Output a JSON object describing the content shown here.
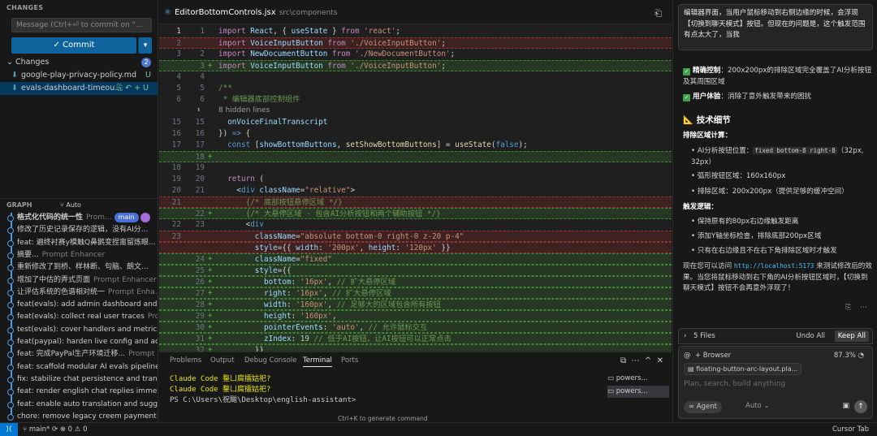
{
  "left": {
    "changes_header": "CHANGES",
    "message_placeholder": "Message (Ctrl+⏎ to commit on \"...",
    "commit_label": "✓ Commit",
    "changes_label": "Changes",
    "changes_count": "2",
    "files": [
      {
        "name": "google-play-privacy-policy.md",
        "status": "U"
      },
      {
        "name": "evals-dashboard-timeou...",
        "status": "U"
      }
    ],
    "graph_header": "GRAPH",
    "graph_auto": "Auto",
    "commits": [
      {
        "msg": "格式化代码的统一性",
        "author": "Prom...",
        "branch": "main"
      },
      {
        "msg": "修改了历史记录保存的逻辑，没有AI分...",
        "author": ""
      },
      {
        "msg": "feat: 遍终衬赛y模触Q鼻鹅变捏甯留炼眼...",
        "author": ""
      },
      {
        "msg": "摘要...",
        "author": "Prompt Enhancer"
      },
      {
        "msg": "重新修改了到桥、样林断、句脑、朗文...",
        "author": ""
      },
      {
        "msg": "增加了中估的弄式页面",
        "author": "Prompt Enhancer"
      },
      {
        "msg": "让评估系统的色谱相对统一",
        "author": "Prompt Enha..."
      },
      {
        "msg": "feat(evals): add admin dashboard and ...",
        "author": ""
      },
      {
        "msg": "feat(evals): collect real user traces",
        "author": "Prom..."
      },
      {
        "msg": "test(evals): cover handlers and metrics...",
        "author": ""
      },
      {
        "msg": "feat(paypal): harden live config and ad...",
        "author": ""
      },
      {
        "msg": "feat: 完成PayPal生产环境迁移...",
        "author": "Prompt ..."
      },
      {
        "msg": "feat: scaffold modular AI evals pipeline...",
        "author": ""
      },
      {
        "msg": "fix: stabilize chat persistence and transl...",
        "author": ""
      },
      {
        "msg": "feat: render english chat replies immedi...",
        "author": ""
      },
      {
        "msg": "feat: enable auto translation and sugge...",
        "author": ""
      },
      {
        "msg": "chore: remove legacy creem payment i...",
        "author": ""
      }
    ]
  },
  "editor": {
    "tab_name": "EditorBottomControls.jsx",
    "tab_path": "src\\components",
    "hidden_lines": "8 hidden lines"
  },
  "panel": {
    "tabs": [
      "Problems",
      "Output",
      "Debug Console",
      "Terminal",
      "Ports"
    ],
    "active_tab": "Terminal",
    "lines": [
      "Claude Code 鍪ㄩ腐擂姑祀?",
      "Claude Code 鍪ㄩ腐擂姑祀?",
      "PS C:\\Users\\祝颰\\Desktop\\english-assistant>"
    ],
    "terminals": [
      "powers...",
      "powers..."
    ],
    "hint": "Ctrl+K to generate command"
  },
  "chat": {
    "bubble": "编辑器界面，当用户鼠标移动到右侧边缘的时候，会浮现【切换到聊天模式】按钮。但现在的问题是，这个触发范围有点太大了，当我",
    "items": [
      {
        "bold": "精确控制",
        "text": "：200x200px的排除区域完全覆盖了AI分析按钮及其周围区域"
      },
      {
        "bold": "用户体验",
        "text": "：消除了意外触发带来的困扰"
      }
    ],
    "heading": "技术细节",
    "calc_title": "排除区域计算：",
    "calc": [
      "AI分析按钮位置：",
      "弧形按钮区域：160x160px",
      "排除区域：200x200px（提供足够的缓冲空间）"
    ],
    "calc_code": "fixed bottom-8 right-8",
    "calc_suffix": "（32px, 32px）",
    "logic_title": "触发逻辑：",
    "logic": [
      "保持原有的80px右边缘触发距离",
      "添加Y轴坐标检查，排除底部200px区域",
      "只有在右边缘且不在右下角排除区域时才触发"
    ],
    "summary_1": "现在您可以访问",
    "summary_link": "http://localhost:5173",
    "summary_2": "来测试修改后的效果。当您将鼠标移动到右下角的AI分析按钮区域时，【切换到聊天模式】按钮不会再意外浮现了！",
    "files_count": "5 Files",
    "undo_all": "Undo All",
    "keep_all": "Keep All",
    "browser": "Browser",
    "percent": "87.3%",
    "attached": "floating-button-arc-layout.pla...",
    "placeholder": "Plan, search, build anything",
    "agent": "∞ Agent",
    "auto": "Auto"
  },
  "status": {
    "branch": "main*",
    "tab": "Cursor Tab"
  }
}
